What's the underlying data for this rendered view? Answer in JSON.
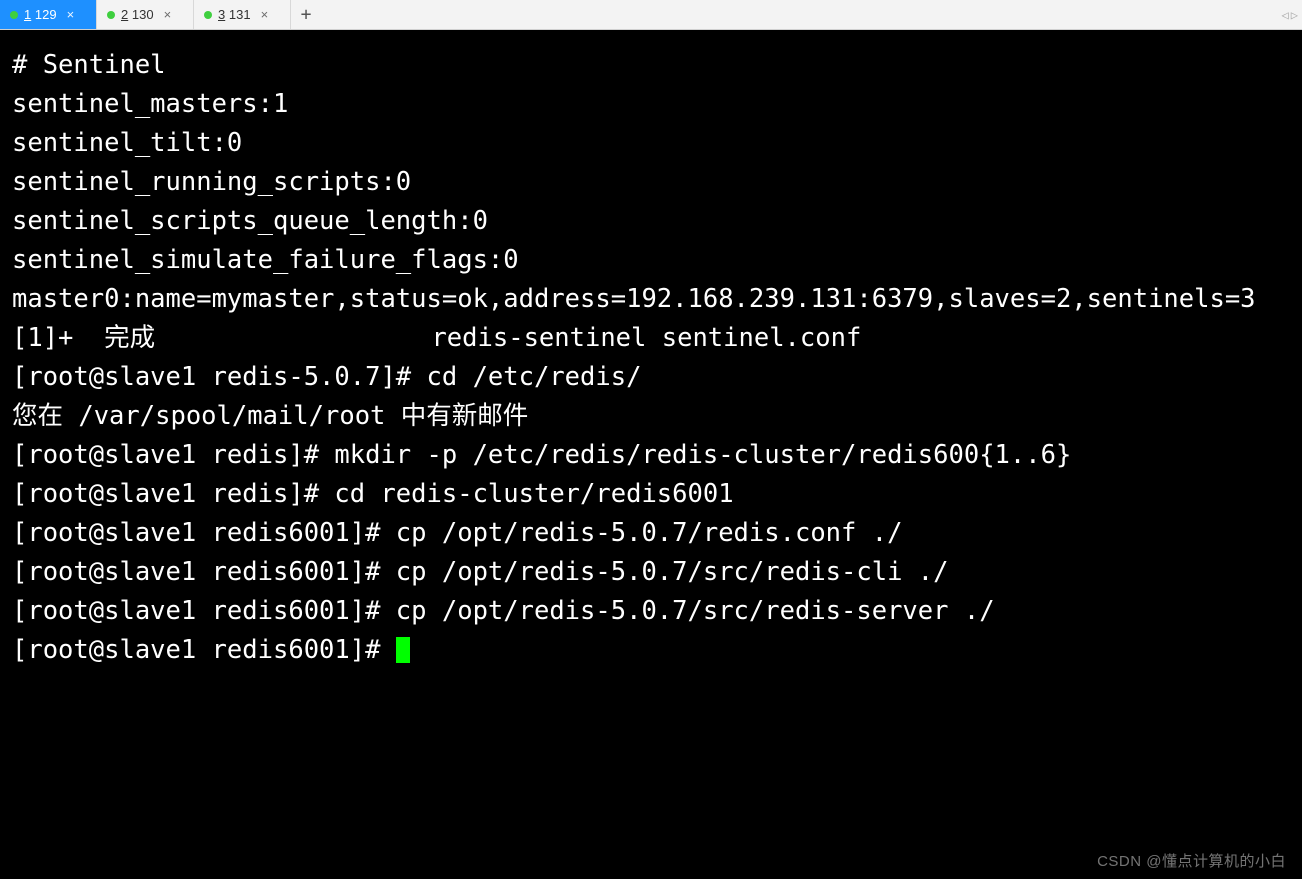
{
  "tabs": [
    {
      "index": "1",
      "label": "129",
      "active": true
    },
    {
      "index": "2",
      "label": "130",
      "active": false
    },
    {
      "index": "3",
      "label": "131",
      "active": false
    }
  ],
  "new_tab_glyph": "+",
  "nav_left": "◁",
  "nav_right": "▷",
  "terminal": {
    "lines": [
      "# Sentinel",
      "sentinel_masters:1",
      "sentinel_tilt:0",
      "sentinel_running_scripts:0",
      "sentinel_scripts_queue_length:0",
      "sentinel_simulate_failure_flags:0",
      "master0:name=mymaster,status=ok,address=192.168.239.131:6379,slaves=2,sentinels=3",
      "[1]+  完成                  redis-sentinel sentinel.conf",
      "[root@slave1 redis-5.0.7]# cd /etc/redis/",
      "您在 /var/spool/mail/root 中有新邮件",
      "[root@slave1 redis]# mkdir -p /etc/redis/redis-cluster/redis600{1..6}",
      "[root@slave1 redis]# cd redis-cluster/redis6001",
      "[root@slave1 redis6001]# cp /opt/redis-5.0.7/redis.conf ./",
      "[root@slave1 redis6001]# cp /opt/redis-5.0.7/src/redis-cli ./",
      "[root@slave1 redis6001]# cp /opt/redis-5.0.7/src/redis-server ./"
    ],
    "current_prompt": "[root@slave1 redis6001]# "
  },
  "watermark": "CSDN @懂点计算机的小白"
}
